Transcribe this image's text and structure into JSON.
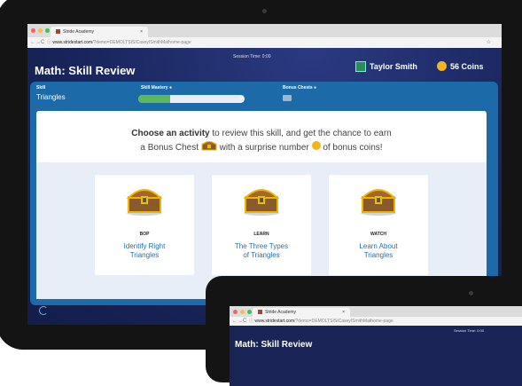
{
  "browser": {
    "tab_title": "Stride Academy",
    "tab_close": "×",
    "url_domain": "www.stridestart.com",
    "url_path": "/?demo=DEMOLTSISICaseyISmithMathome-page",
    "star": "☆"
  },
  "header": {
    "title": "Math: Skill Review",
    "session_time": "Session Time: 0:00",
    "user_name": "Taylor Smith",
    "coins": "56 Coins"
  },
  "skill_bar": {
    "skill_label": "Skill",
    "skill_value": "Triangles",
    "mastery_label": "Skill Mastery",
    "mastery_progress": 0.3,
    "bonus_label": "Bonus Chests"
  },
  "prompt": {
    "bold": "Choose an activity",
    "line1_rest": " to review this skill, and get the chance to earn",
    "line2_a": "a Bonus Chest",
    "line2_b": "with a surprise number",
    "line2_c": "of bonus coins!"
  },
  "activities": [
    {
      "category": "BOP",
      "title_1": "Identify Right",
      "title_2": "Triangles"
    },
    {
      "category": "LEARN",
      "title_1": "The Three Types",
      "title_2": "of Triangles"
    },
    {
      "category": "WATCH",
      "title_1": "Learn About",
      "title_2": "Triangles"
    }
  ],
  "second_device": {
    "tab_title": "Stride Academy",
    "tab_close": "×",
    "url_domain": "www.stridestart.com",
    "url_path": "/?demo=DEMOLTSISICaseyISmithMathome-page",
    "title": "Math: Skill Review",
    "session_time": "Session Time: 0:00"
  },
  "colors": {
    "panel": "#1c6aa8",
    "link": "#1f6fb5",
    "mastery": "#5cb85c",
    "coin": "#f4b41a"
  },
  "icons": [
    "info-icon",
    "treasure-chest-icon",
    "coin-icon",
    "refresh-icon",
    "user-avatar-icon"
  ]
}
